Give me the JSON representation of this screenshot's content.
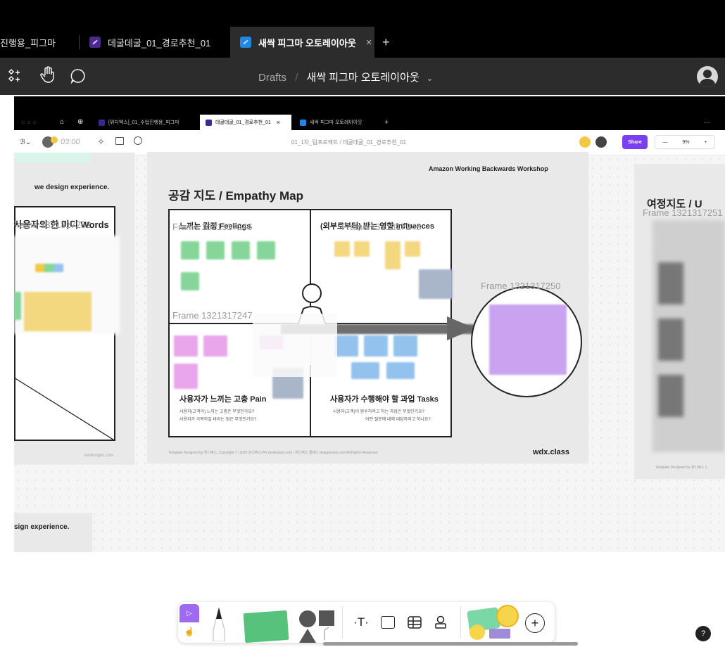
{
  "tabs": [
    {
      "label": "진행용_피그마",
      "active": false
    },
    {
      "label": "데굴데굴_01_경로추천_01",
      "active": false
    },
    {
      "label": "새싹 피그마 오토레이아웃",
      "active": true
    }
  ],
  "tab_close": "×",
  "tab_add": "+",
  "breadcrumb": {
    "root": "Drafts",
    "sep": "/",
    "file": "새싹 피그마 오토레이아웃"
  },
  "inner": {
    "tabs": [
      {
        "label": "[위디엑스]_01_수업진행용_피그마",
        "active": false
      },
      {
        "label": "데굴데굴_01_경로추천_01",
        "active": true
      },
      {
        "label": "새싹 피그마 오토레이아웃",
        "active": false
      }
    ],
    "tab_close": "×",
    "tab_add": "+",
    "more": "···",
    "timer": "03:00",
    "breadcrumb": "01_1차_팀프로젝트 / 데굴데굴_01_경로추천_01",
    "share": "Share",
    "zoom": "9%",
    "zoom_minus": "—",
    "zoom_plus": "+"
  },
  "board": {
    "header": "Amazon Working Backwards Workshop",
    "title": "공감 지도 / Empathy Map",
    "q1": "느끼는 감정 Feelings",
    "q2": "(외부로부터) 받는 영향 Influences",
    "q3": "사용자가 느끼는 고충 Pain",
    "q3_sub1": "사용자(고객이) 느끼는 고충은 무엇인가요?",
    "q3_sub2": "사용자가 극복하길 바라는 점은 무엇인가요?",
    "q4": "사용자가 수행해야 할 과업 Tasks",
    "q4_sub1": "사용자(고객)이 완수하려고 하는 과업은 무엇인가요?",
    "q4_sub2": "어떤 질문에 대해 대답하려고 하나요?",
    "footer": "Template Designed by 위디엑스, Copyright ⓒ 2020 위디엑스(주) wedesigns.com / 위디엑스 클래스 designclass.com All Rights Reserved.",
    "brand": "wdx.class",
    "frame_a": "Frame 1321317246",
    "frame_b": "Frame 1321317248",
    "frame_c": "Frame 1321317247",
    "frame_d": "Frame 1321317250"
  },
  "left_board": {
    "tagline": "we design experience.",
    "title": "사용자의 한 마디 Words",
    "frame": "Frame 1321317252",
    "footer": "wedesigns.com",
    "bottom_tagline": "sign experience."
  },
  "right_board": {
    "title": "여정지도 / U",
    "frame": "Frame 1321317251",
    "footer": "Template Designed by 위디엑스 1"
  },
  "help": "?"
}
